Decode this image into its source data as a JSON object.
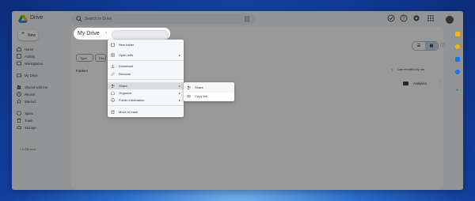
{
  "app": {
    "name": "Drive"
  },
  "search": {
    "placeholder": "Search in Drive"
  },
  "sidebar": {
    "new_label": "New",
    "items": [
      {
        "label": "Home",
        "icon": "home-icon"
      },
      {
        "label": "Activity",
        "icon": "activity-icon"
      },
      {
        "label": "Workspaces",
        "icon": "workspaces-icon"
      },
      {
        "label": "My Drive",
        "icon": "my-drive-icon"
      },
      {
        "label": "Shared with me",
        "icon": "shared-icon"
      },
      {
        "label": "Recent",
        "icon": "clock-icon"
      },
      {
        "label": "Starred",
        "icon": "star-icon"
      },
      {
        "label": "Spam",
        "icon": "spam-icon"
      },
      {
        "label": "Trash",
        "icon": "trash-icon"
      },
      {
        "label": "Storage",
        "icon": "cloud-icon"
      }
    ],
    "storage_text": "1.4 GB used"
  },
  "main": {
    "title": "My Drive",
    "filters": [
      "Type",
      "Peo"
    ],
    "folders_label": "Folders",
    "sort_label": "Last modified by me",
    "folder": {
      "name": "Analytics"
    }
  },
  "context_menu": {
    "items": [
      {
        "label": "New folder",
        "icon": "new-folder-icon"
      },
      {
        "label": "Open with",
        "icon": "open-with-icon",
        "has_submenu": true
      },
      {
        "label": "Download",
        "icon": "download-icon"
      },
      {
        "label": "Rename",
        "icon": "rename-icon"
      },
      {
        "label": "Share",
        "icon": "share-icon",
        "has_submenu": true,
        "highlighted": true
      },
      {
        "label": "Organize",
        "icon": "organize-icon",
        "has_submenu": true
      },
      {
        "label": "Folder information",
        "icon": "info-icon",
        "has_submenu": true
      },
      {
        "label": "Move to trash",
        "icon": "trash-icon"
      }
    ]
  },
  "share_submenu": {
    "items": [
      {
        "label": "Share",
        "icon": "person-add-icon"
      },
      {
        "label": "Copy link",
        "icon": "link-icon",
        "highlighted": true
      }
    ]
  },
  "colors": {
    "accent": "#1a73e8",
    "highlight": "#d8dbe2",
    "background": "#123e9c"
  }
}
